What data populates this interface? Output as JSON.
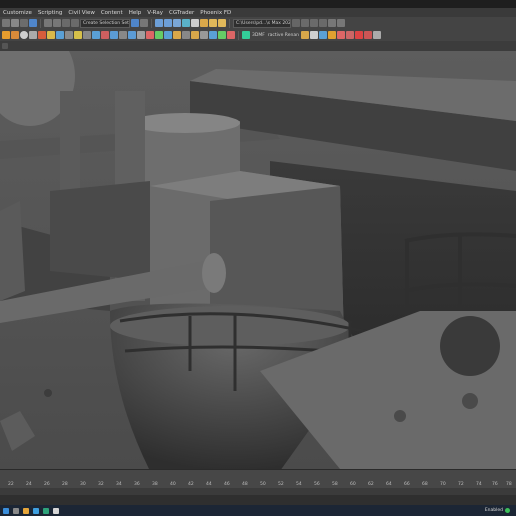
{
  "menu": [
    "Customize",
    "Scripting",
    "Civil View",
    "Content",
    "Help",
    "V-Ray",
    "CGTrader",
    "Phoenix FD"
  ],
  "toolbar": {
    "selection_set": "Create Selection Set",
    "file_path": "C:\\Users\\pd...\\s Max 202",
    "label_a": "3DMF",
    "label_b": "ractive Renan"
  },
  "timeline": {
    "ticks": [
      "22",
      "24",
      "26",
      "28",
      "30",
      "32",
      "34",
      "36",
      "38",
      "40",
      "42",
      "44",
      "46",
      "48",
      "50",
      "52",
      "54",
      "56",
      "58",
      "60",
      "62",
      "64",
      "66",
      "68",
      "70",
      "72",
      "74",
      "76",
      "78"
    ]
  },
  "status": {
    "enabled": "Enabled"
  },
  "colors": {
    "accent": "#3cbf5a",
    "viewport_bg": "#5a5a5a"
  }
}
